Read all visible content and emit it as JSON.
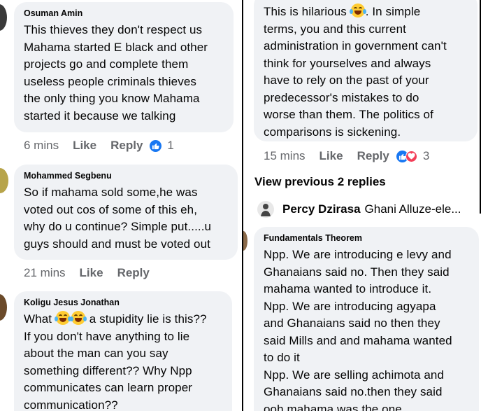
{
  "left_comments": [
    {
      "author": "Osuman Amin",
      "text": "This thieves they don't respect us\nMahama started E black and other\nprojects go and complete them\nuseless people criminals thieves\nthe only thing you know Mahama\nstarted it because we talking",
      "time": "6 mins",
      "like_label": "Like",
      "reply_label": "Reply",
      "reaction_count": "1"
    },
    {
      "author": "Mohammed Segbenu",
      "text": "So if mahama sold some,he was\nvoted out cos of some of this eh,\nwhy do u continue? Simple put.....u\nguys should and must be voted out",
      "time": "21 mins",
      "like_label": "Like",
      "reply_label": "Reply"
    },
    {
      "author": "Koligu Jesus Jonathan",
      "text_prefix": "What ",
      "text_after_emoji": " a stupidity lie is this??\nIf you don't have anything to lie\nabout the man can you say\nsomething different?? Why Npp\ncommunicates can learn proper\ncommunication??"
    }
  ],
  "right_comment_top": {
    "text_prefix": "This is hilarious ",
    "text_after_emoji": ". In simple\nterms, you and this current\nadministration in government can't\nthink for yourselves and always\nhave to rely on the past of your\npredecessor's mistakes to do\nworse than them. The politics of\ncomparisons is sickening.",
    "time": "15 mins",
    "like_label": "Like",
    "reply_label": "Reply",
    "reaction_count": "3"
  },
  "view_previous_label": "View previous 2 replies",
  "reply_preview": {
    "name": "Percy Dzirasa",
    "snippet": "Ghani Alluze-ele..."
  },
  "right_comment_bottom": {
    "author": "Fundamentals Theorem",
    "text": "Npp. We are introducing e levy and\nGhanaians said no. Then they said\nmahama wanted to introduce it.\nNpp. We are introducing agyapa\nand Ghanaians said no then they\nsaid Mills and and mahama wanted\nto do it\nNpp. We are selling achimota and\nGhanaians said no.then they said\nooh mahama was the one."
  },
  "colors": {
    "bubble": "#f0f2f5",
    "meta_text": "#65676b",
    "like_blue": "#1877f2",
    "love_red": "#f33e58"
  },
  "icons": [
    "like-reaction-icon",
    "love-reaction-icon",
    "laughing-emoji-icon",
    "avatar"
  ]
}
